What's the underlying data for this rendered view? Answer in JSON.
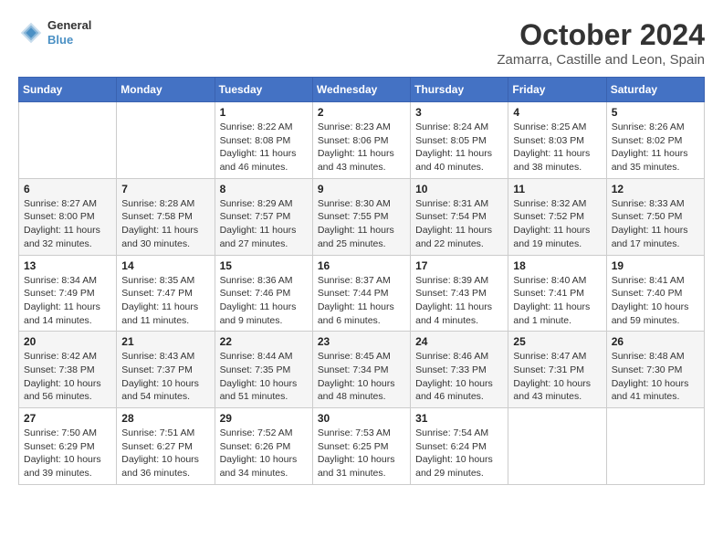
{
  "header": {
    "logo_line1": "General",
    "logo_line2": "Blue",
    "month": "October 2024",
    "location": "Zamarra, Castille and Leon, Spain"
  },
  "days_of_week": [
    "Sunday",
    "Monday",
    "Tuesday",
    "Wednesday",
    "Thursday",
    "Friday",
    "Saturday"
  ],
  "weeks": [
    [
      {
        "day": "",
        "info": ""
      },
      {
        "day": "",
        "info": ""
      },
      {
        "day": "1",
        "info": "Sunrise: 8:22 AM\nSunset: 8:08 PM\nDaylight: 11 hours and 46 minutes."
      },
      {
        "day": "2",
        "info": "Sunrise: 8:23 AM\nSunset: 8:06 PM\nDaylight: 11 hours and 43 minutes."
      },
      {
        "day": "3",
        "info": "Sunrise: 8:24 AM\nSunset: 8:05 PM\nDaylight: 11 hours and 40 minutes."
      },
      {
        "day": "4",
        "info": "Sunrise: 8:25 AM\nSunset: 8:03 PM\nDaylight: 11 hours and 38 minutes."
      },
      {
        "day": "5",
        "info": "Sunrise: 8:26 AM\nSunset: 8:02 PM\nDaylight: 11 hours and 35 minutes."
      }
    ],
    [
      {
        "day": "6",
        "info": "Sunrise: 8:27 AM\nSunset: 8:00 PM\nDaylight: 11 hours and 32 minutes."
      },
      {
        "day": "7",
        "info": "Sunrise: 8:28 AM\nSunset: 7:58 PM\nDaylight: 11 hours and 30 minutes."
      },
      {
        "day": "8",
        "info": "Sunrise: 8:29 AM\nSunset: 7:57 PM\nDaylight: 11 hours and 27 minutes."
      },
      {
        "day": "9",
        "info": "Sunrise: 8:30 AM\nSunset: 7:55 PM\nDaylight: 11 hours and 25 minutes."
      },
      {
        "day": "10",
        "info": "Sunrise: 8:31 AM\nSunset: 7:54 PM\nDaylight: 11 hours and 22 minutes."
      },
      {
        "day": "11",
        "info": "Sunrise: 8:32 AM\nSunset: 7:52 PM\nDaylight: 11 hours and 19 minutes."
      },
      {
        "day": "12",
        "info": "Sunrise: 8:33 AM\nSunset: 7:50 PM\nDaylight: 11 hours and 17 minutes."
      }
    ],
    [
      {
        "day": "13",
        "info": "Sunrise: 8:34 AM\nSunset: 7:49 PM\nDaylight: 11 hours and 14 minutes."
      },
      {
        "day": "14",
        "info": "Sunrise: 8:35 AM\nSunset: 7:47 PM\nDaylight: 11 hours and 11 minutes."
      },
      {
        "day": "15",
        "info": "Sunrise: 8:36 AM\nSunset: 7:46 PM\nDaylight: 11 hours and 9 minutes."
      },
      {
        "day": "16",
        "info": "Sunrise: 8:37 AM\nSunset: 7:44 PM\nDaylight: 11 hours and 6 minutes."
      },
      {
        "day": "17",
        "info": "Sunrise: 8:39 AM\nSunset: 7:43 PM\nDaylight: 11 hours and 4 minutes."
      },
      {
        "day": "18",
        "info": "Sunrise: 8:40 AM\nSunset: 7:41 PM\nDaylight: 11 hours and 1 minute."
      },
      {
        "day": "19",
        "info": "Sunrise: 8:41 AM\nSunset: 7:40 PM\nDaylight: 10 hours and 59 minutes."
      }
    ],
    [
      {
        "day": "20",
        "info": "Sunrise: 8:42 AM\nSunset: 7:38 PM\nDaylight: 10 hours and 56 minutes."
      },
      {
        "day": "21",
        "info": "Sunrise: 8:43 AM\nSunset: 7:37 PM\nDaylight: 10 hours and 54 minutes."
      },
      {
        "day": "22",
        "info": "Sunrise: 8:44 AM\nSunset: 7:35 PM\nDaylight: 10 hours and 51 minutes."
      },
      {
        "day": "23",
        "info": "Sunrise: 8:45 AM\nSunset: 7:34 PM\nDaylight: 10 hours and 48 minutes."
      },
      {
        "day": "24",
        "info": "Sunrise: 8:46 AM\nSunset: 7:33 PM\nDaylight: 10 hours and 46 minutes."
      },
      {
        "day": "25",
        "info": "Sunrise: 8:47 AM\nSunset: 7:31 PM\nDaylight: 10 hours and 43 minutes."
      },
      {
        "day": "26",
        "info": "Sunrise: 8:48 AM\nSunset: 7:30 PM\nDaylight: 10 hours and 41 minutes."
      }
    ],
    [
      {
        "day": "27",
        "info": "Sunrise: 7:50 AM\nSunset: 6:29 PM\nDaylight: 10 hours and 39 minutes."
      },
      {
        "day": "28",
        "info": "Sunrise: 7:51 AM\nSunset: 6:27 PM\nDaylight: 10 hours and 36 minutes."
      },
      {
        "day": "29",
        "info": "Sunrise: 7:52 AM\nSunset: 6:26 PM\nDaylight: 10 hours and 34 minutes."
      },
      {
        "day": "30",
        "info": "Sunrise: 7:53 AM\nSunset: 6:25 PM\nDaylight: 10 hours and 31 minutes."
      },
      {
        "day": "31",
        "info": "Sunrise: 7:54 AM\nSunset: 6:24 PM\nDaylight: 10 hours and 29 minutes."
      },
      {
        "day": "",
        "info": ""
      },
      {
        "day": "",
        "info": ""
      }
    ]
  ]
}
